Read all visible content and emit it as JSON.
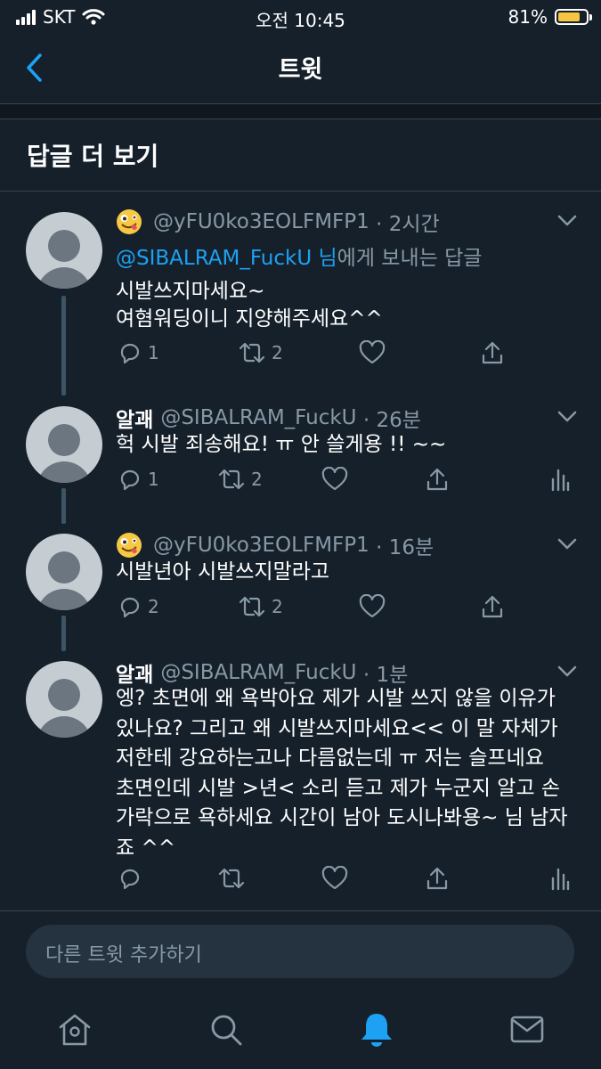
{
  "status_bar": {
    "carrier": "SKT",
    "time": "오전 10:45",
    "battery": "81%",
    "battery_level": 0.81
  },
  "nav": {
    "title": "트윗"
  },
  "section": {
    "title": "답글 더 보기"
  },
  "tweets": [
    {
      "name": "",
      "handle": "@yFU0ko3EOLFMFP1",
      "time": "· 2시간",
      "reply_mention": "@SIBALRAM_FuckU 님",
      "reply_suffix": "에게 보내는 답글",
      "lines": [
        "시발쓰지마세요~",
        "여혐워딩이니 지양해주세요^^"
      ],
      "reply_count": "1",
      "retweet_count": "2"
    },
    {
      "name": "알괘",
      "handle": "@SIBALRAM_FuckU",
      "time": "· 26분",
      "lines": [
        "헉 시발 죄송해요! ㅠ 안 쓸게용 !! ~~"
      ],
      "reply_count": "1",
      "retweet_count": "2"
    },
    {
      "name": "",
      "handle": "@yFU0ko3EOLFMFP1",
      "time": "· 16분",
      "lines": [
        "시발년아 시발쓰지말라고"
      ],
      "reply_count": "2",
      "retweet_count": "2"
    },
    {
      "name": "알괘",
      "handle": "@SIBALRAM_FuckU",
      "time": "· 1분",
      "lines": [
        "엥? 초면에 왜 욕박아요 제가 시발 쓰지 않을 이유가",
        "있나요? 그리고 왜 시발쓰지마세요<< 이 말 자체가",
        "저한테 강요하는고나 다름없는데 ㅠ 저는 슬프네요",
        "초면인데 시발 >년< 소리 듣고 제가 누군지 알고 손",
        "가락으로 욕하세요 시간이 남아 도시나봐용~ 님 남자",
        "죠 ^^"
      ]
    }
  ],
  "composer": {
    "placeholder": "다른 트윗 추가하기"
  },
  "tabs": [
    {
      "icon": "home-icon"
    },
    {
      "icon": "search-icon"
    },
    {
      "icon": "notifications-icon",
      "active": true
    },
    {
      "icon": "messages-icon"
    }
  ],
  "colors": {
    "background": "#15202b",
    "accent": "#1da1f2",
    "muted": "#8899a6",
    "divider": "#38444d"
  }
}
